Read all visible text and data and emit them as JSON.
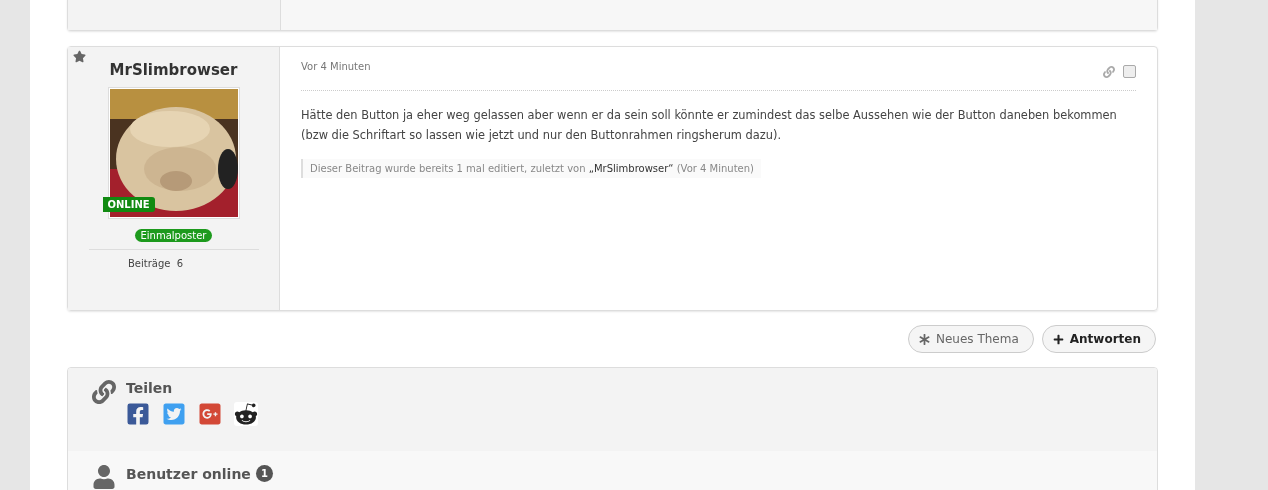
{
  "post": {
    "author": "MrSlimbrowser",
    "starred": true,
    "online_badge": "ONLINE",
    "rank": "Einmalposter",
    "stats": [
      {
        "label": "Beiträge",
        "value": "6"
      }
    ],
    "time": "Vor 4 Minuten",
    "selected": false,
    "body": "Hätte den Button ja eher weg gelassen aber wenn er da sein soll könnte er zumindest das selbe Aussehen wie der Button daneben bekommen (bzw die Schriftart so lassen wie jetzt und nur den Buttonrahmen ringsherum dazu).",
    "edit_note": {
      "prefix": "Dieser Beitrag wurde bereits 1 mal editiert, zuletzt von ",
      "user": "„MrSlimbrowser“",
      "suffix": " (Vor 4 Minuten)"
    }
  },
  "actions": [
    {
      "kind": "new",
      "label": "Neues Thema"
    },
    {
      "kind": "reply",
      "label": "Antworten"
    }
  ],
  "share": {
    "title": "Teilen",
    "networks": [
      {
        "kind": "facebook"
      },
      {
        "kind": "twitter"
      },
      {
        "kind": "googleplus"
      },
      {
        "kind": "reddit"
      }
    ]
  },
  "online": {
    "title": "Benutzer online",
    "count": "1"
  }
}
